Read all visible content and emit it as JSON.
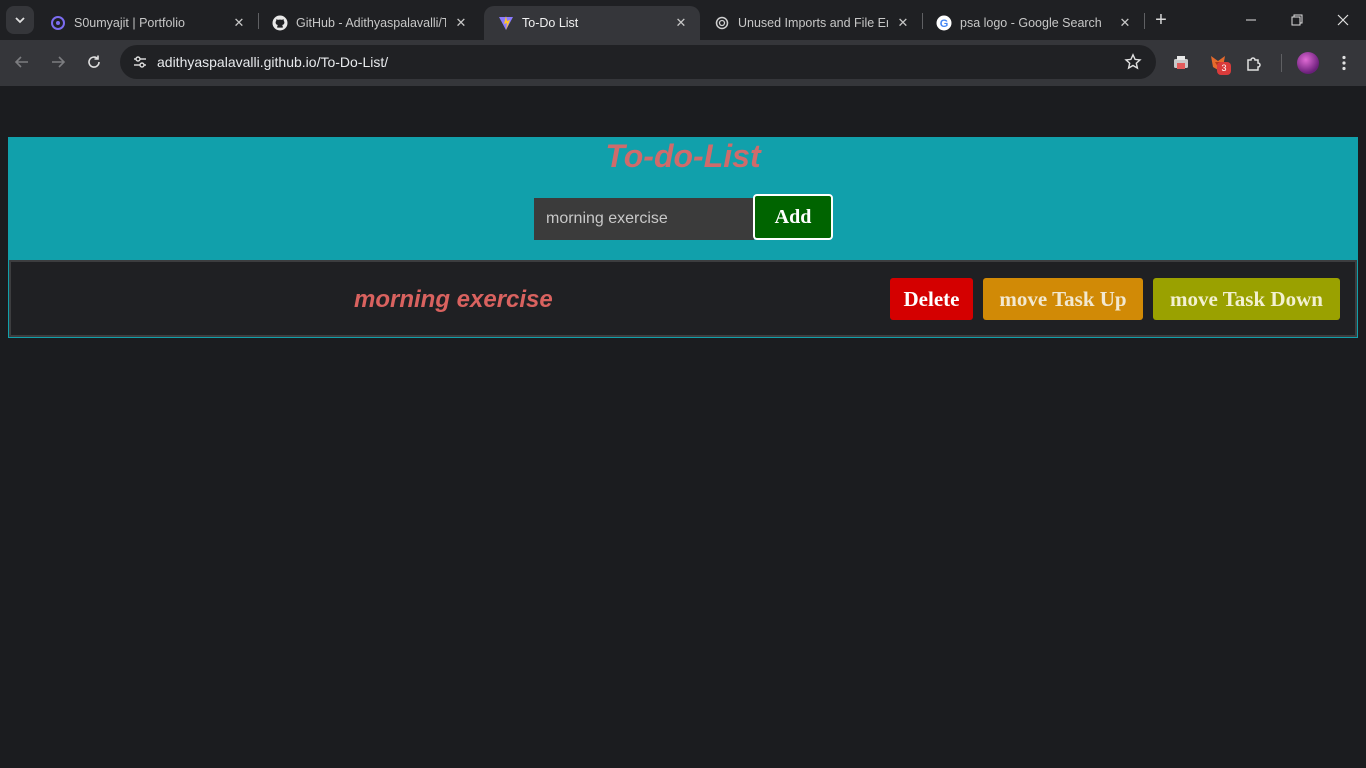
{
  "browser": {
    "tabs": [
      {
        "title": "S0umyajit | Portfolio",
        "icon": "portfolio-logo-icon"
      },
      {
        "title": "GitHub - Adithyaspalavalli/To-Do-List",
        "icon": "github-icon"
      },
      {
        "title": "To-Do List",
        "icon": "vite-logo-icon",
        "active": true
      },
      {
        "title": "Unused Imports and File Errors",
        "icon": "openai-icon"
      },
      {
        "title": "psa logo - Google Search",
        "icon": "google-icon"
      }
    ],
    "url_domain": "adithyaspalavalli.github.io",
    "url_path": "/To-Do-List/",
    "extension_badge": "3"
  },
  "app": {
    "title": "To-do-List",
    "input_value": "morning exercise",
    "add_label": "Add",
    "tasks": [
      {
        "text": "morning exercise",
        "delete_label": "Delete",
        "up_label": "move Task Up",
        "down_label": "move Task Down"
      }
    ]
  },
  "colors": {
    "app_background": "#11a0ab",
    "title_color": "#cf6b6b",
    "add_button": "#006400",
    "delete_button": "#d40000",
    "up_button": "#d18a06",
    "down_button": "#9aa100"
  }
}
